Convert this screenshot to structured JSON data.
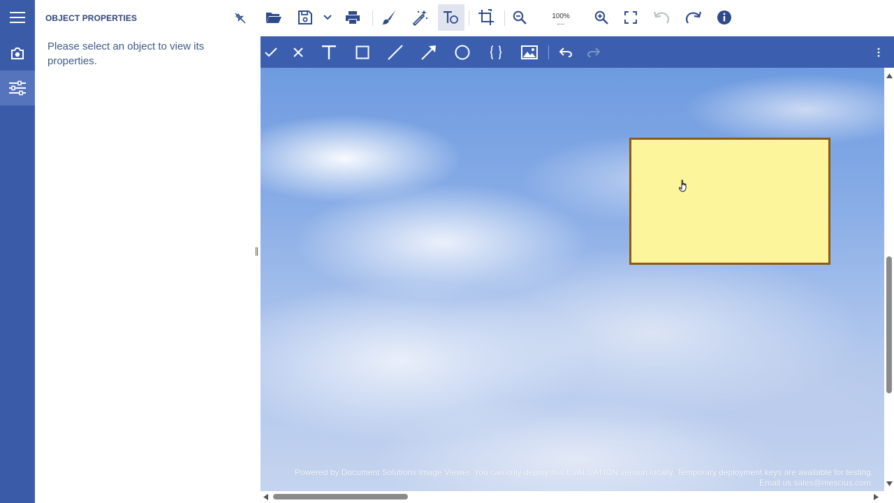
{
  "panel": {
    "title": "OBJECT PROPERTIES",
    "message": "Please select an object to view its properties."
  },
  "left_strip": {
    "items": [
      {
        "icon": "hamburger-menu-icon"
      },
      {
        "icon": "camera-icon"
      },
      {
        "icon": "sliders-icon",
        "active": true
      }
    ]
  },
  "toolbar": {
    "icons": [
      "unpin-icon",
      "folder-open-icon",
      "save-icon",
      "chevron-down-icon",
      "print-icon",
      "paint-brush-icon",
      "magic-wand-icon",
      "text-object-icon",
      "crop-icon",
      "zoom-out-icon",
      "zoom-in-icon",
      "fullscreen-icon",
      "undo-icon",
      "redo-icon",
      "info-icon"
    ],
    "zoom_level": "100%"
  },
  "annotation_toolbar": {
    "icons": [
      "check-icon",
      "close-icon",
      "text-icon",
      "rectangle-icon",
      "line-icon",
      "arrow-icon",
      "ellipse-icon",
      "brackets-icon",
      "image-icon",
      "undo-icon",
      "redo-icon",
      "more-vertical-icon"
    ]
  },
  "canvas": {
    "watermark_line1": "Powered by Document Solutions Image Viewer. You can only deploy this EVALUATION version locally. Temporary deployment keys are available for testing.",
    "watermark_line2": "Email us sales@mescius.com."
  },
  "colors": {
    "brand": "#3a5ba8",
    "annotation_bar": "#3b5fae",
    "sticky_fill": "#fdf59c",
    "sticky_border": "#8a5a16",
    "icon": "#2d4a8c"
  }
}
